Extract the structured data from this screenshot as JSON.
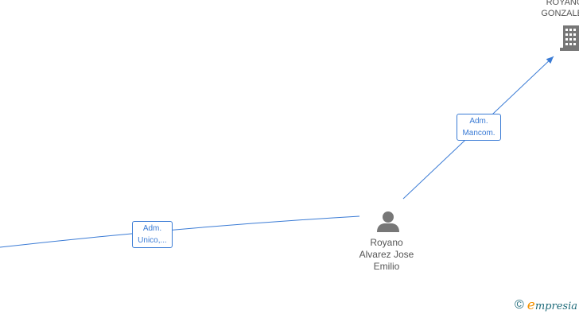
{
  "diagram": {
    "nodes": {
      "person": {
        "label": "Royano\nAlvarez Jose\nEmilio",
        "icon": "person-icon"
      },
      "company": {
        "label": "ROYANO\nGONZALEZ",
        "icon": "building-icon"
      }
    },
    "edges": {
      "left": {
        "label": "Adm.\nUnico,..."
      },
      "right": {
        "label": "Adm.\nMancom."
      }
    },
    "colors": {
      "edge": "#3a7bd5",
      "icon": "#777777",
      "text": "#555555"
    }
  },
  "brand": {
    "copyright": "©",
    "first_letter": "e",
    "rest": "mpresia"
  }
}
